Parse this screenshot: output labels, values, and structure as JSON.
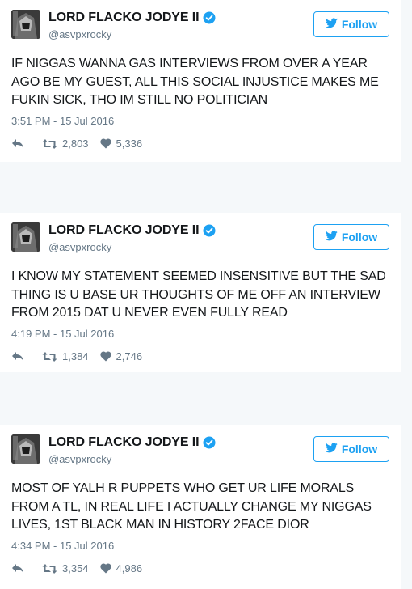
{
  "colors": {
    "twitter_blue": "#1da1f2",
    "secondary_text": "#657786",
    "page_bg": "#f5f8fa"
  },
  "tweets": [
    {
      "display_name": "LORD FLACKO JODYE II",
      "handle": "@asvpxrocky",
      "follow_label": "Follow",
      "text": "IF NIGGAS WANNA GAS INTERVIEWS FROM OVER A YEAR AGO BE MY GUEST, ALL THIS SOCIAL INJUSTICE MAKES ME FUKIN SICK, THO IM STILL NO POLITICIAN",
      "timestamp": "3:51 PM - 15 Jul 2016",
      "retweets": "2,803",
      "likes": "5,336",
      "icons": [
        "verified-badge-icon",
        "twitter-bird-icon",
        "reply-icon",
        "retweet-icon",
        "heart-icon"
      ]
    },
    {
      "display_name": "LORD FLACKO JODYE II",
      "handle": "@asvpxrocky",
      "follow_label": "Follow",
      "text": "I KNOW MY STATEMENT SEEMED INSENSITIVE BUT THE SAD THING IS U BASE UR THOUGHTS OF ME OFF AN INTERVIEW FROM 2015 DAT U NEVER EVEN FULLY READ",
      "timestamp": "4:19 PM - 15 Jul 2016",
      "retweets": "1,384",
      "likes": "2,746",
      "icons": [
        "verified-badge-icon",
        "twitter-bird-icon",
        "reply-icon",
        "retweet-icon",
        "heart-icon"
      ]
    },
    {
      "display_name": "LORD FLACKO JODYE II",
      "handle": "@asvpxrocky",
      "follow_label": "Follow",
      "text": "MOST OF YALH R PUPPETS WHO GET UR LIFE MORALS FROM A TL, IN REAL LIFE I ACTUALLY CHANGE MY NIGGAS LIVES, 1ST BLACK MAN IN HISTORY 2FACE DIOR",
      "timestamp": "4:34 PM - 15 Jul 2016",
      "retweets": "3,354",
      "likes": "4,986",
      "icons": [
        "verified-badge-icon",
        "twitter-bird-icon",
        "reply-icon",
        "retweet-icon",
        "heart-icon"
      ]
    }
  ]
}
